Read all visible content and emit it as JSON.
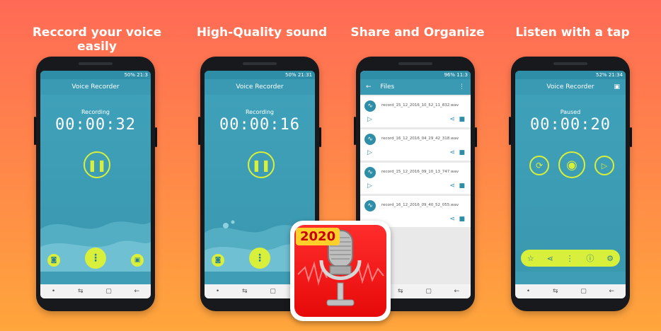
{
  "captions": [
    "Reccord your voice easily",
    "High-Quality sound",
    "Share and Organize",
    "Listen with a tap"
  ],
  "screen1": {
    "status_time": "21:3",
    "status_battery": "50%",
    "title": "Voice Recorder",
    "label": "Recording",
    "time": "00:00:32"
  },
  "screen2": {
    "status_time": "21:31",
    "status_battery": "50%",
    "title": "Voice Recorder",
    "label": "Recording",
    "time": "00:00:16"
  },
  "screen3": {
    "status_time": "11:3",
    "status_battery": "96%",
    "title": "Files",
    "files": [
      "record_15_12_2016_10_52_11_832.wav",
      "record_16_12_2016_04_29_42_318.wav",
      "record_15_12_2016_09_10_13_747.wav",
      "record_16_12_2016_09_40_52_055.wav"
    ]
  },
  "screen4": {
    "status_time": "21:34",
    "status_battery": "52%",
    "title": "Voice Recorder",
    "label": "Paused",
    "time": "00:00:20"
  },
  "badge": {
    "year": "2020"
  },
  "colors": {
    "accent": "#d8ef3b",
    "teal": "#3f9eb6",
    "bg_top": "#ff6a56",
    "bg_bottom": "#ffa63c"
  }
}
